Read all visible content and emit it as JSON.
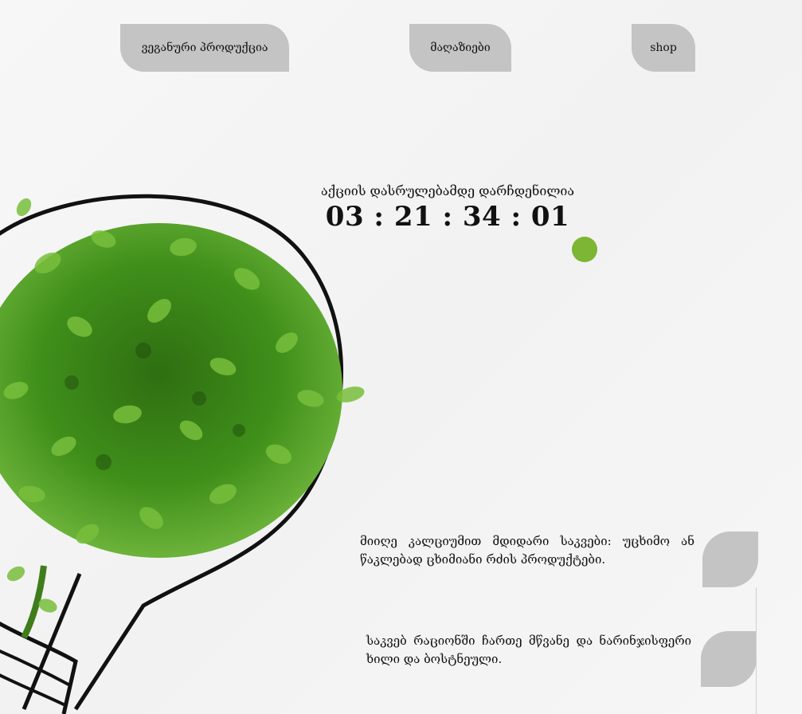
{
  "nav": {
    "tabs": [
      {
        "label": "ვეგანური პროდუქცია"
      },
      {
        "label": "მაღაზიები"
      },
      {
        "label": "shop"
      }
    ]
  },
  "countdown": {
    "label": "აქციის დასრულებამდე დარჩდენილია",
    "time": "03 : 21 : 34 : 01"
  },
  "colors": {
    "accent_green": "#7db534",
    "tab_gray": "#c4c4c4",
    "background": "#f5f5f5"
  },
  "promos": [
    {
      "text": "მიიღე კალციუმით მდიდარი საკვები: უცხიმო ან წაკლებად ცხიმიანი რძის პროდუქტები."
    },
    {
      "text": "საკვებ რაციონში ჩართე მწვანე და ნარინჯისფერი ხილი და ბოსტნეული."
    }
  ],
  "illustration": {
    "icon": "lightbulb-plant-icon"
  }
}
